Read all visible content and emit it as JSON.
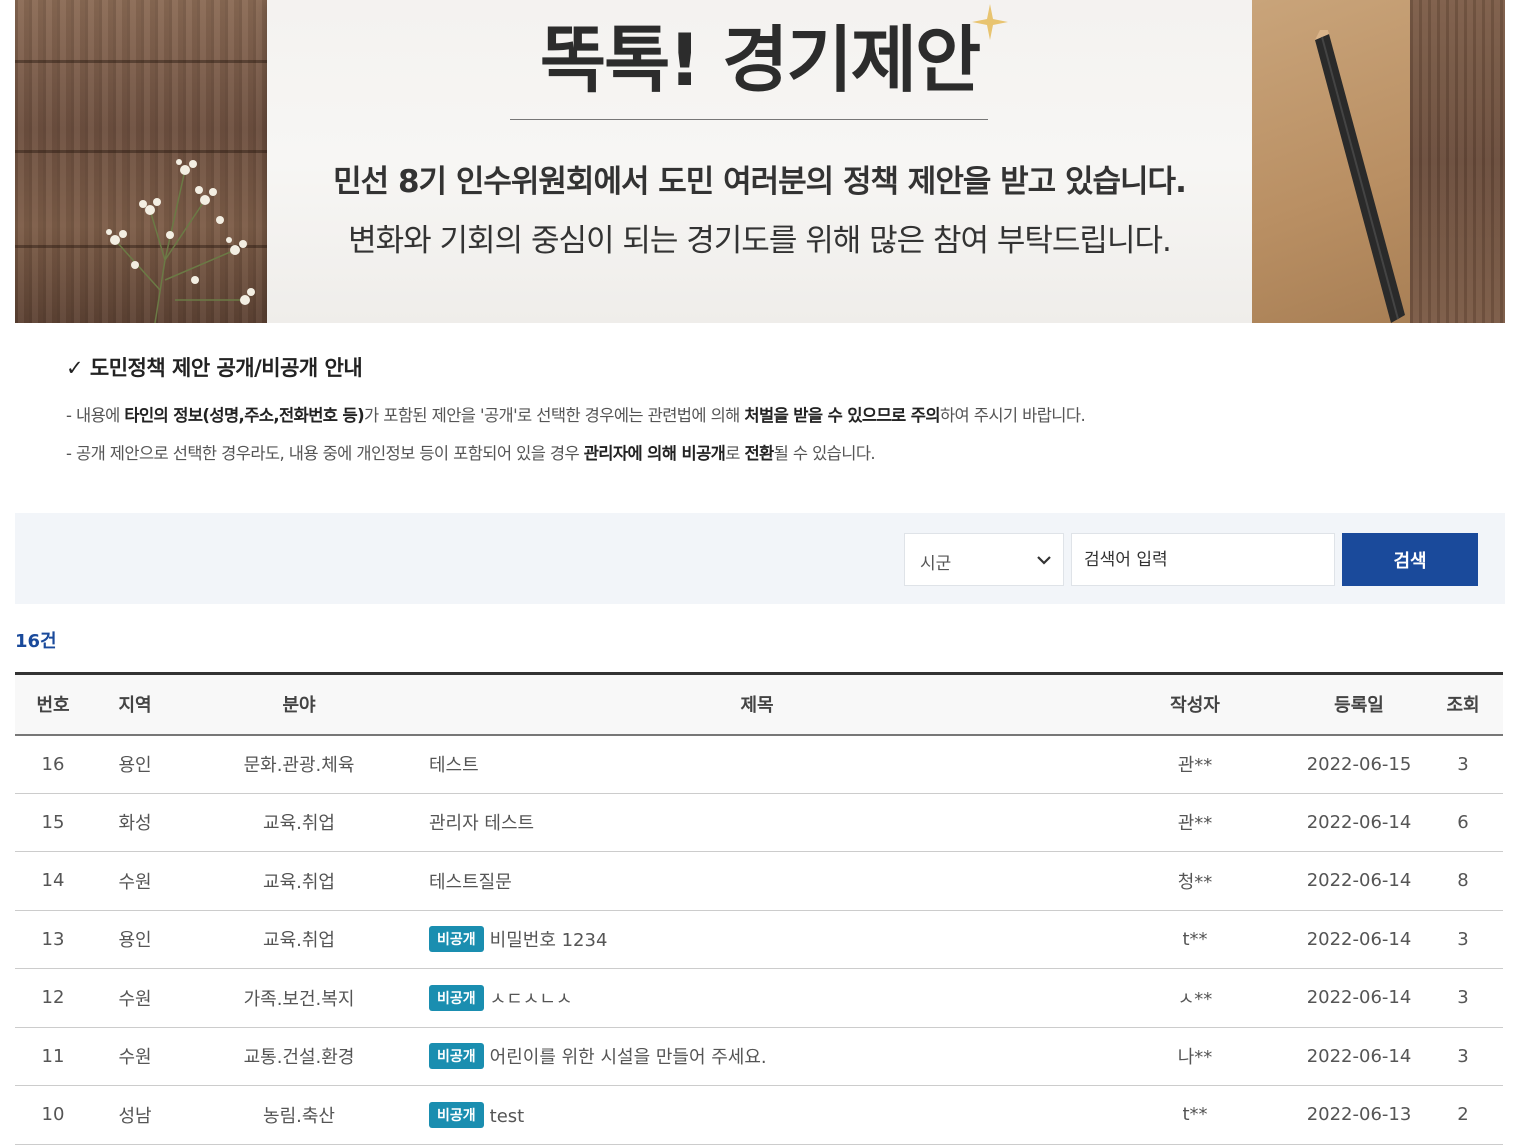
{
  "banner": {
    "title": "똑톡! 경기제안",
    "line1": "민선 8기 인수위원회에서 도민 여러분의 정책 제안을 받고 있습니다.",
    "line2": "변화와 기회의 중심이 되는 경기도를 위해 많은 참여 부탁드립니다."
  },
  "notice": {
    "title": "✓ 도민정책 제안 공개/비공개 안내",
    "line1": {
      "p1": "- 내용에 ",
      "b1": "타인의 정보(성명,주소,전화번호 등)",
      "p2": "가 포함된 제안을 '공개'로 선택한 경우에는 관련법에 의해 ",
      "b2": "처벌을 받을 수 있으므로 주의",
      "p3": "하여 주시기 바랍니다."
    },
    "line2": {
      "p1": "- 공개 제안으로 선택한 경우라도, 내용 중에 개인정보 등이 포함되어 있을 경우 ",
      "b1": "관리자에 의해 비공개",
      "p2": "로 ",
      "b2": "전환",
      "p3": "될 수 있습니다."
    }
  },
  "search": {
    "region_select": "시군",
    "input_placeholder": "검색어 입력",
    "button_label": "검색"
  },
  "total_count": "16건",
  "table": {
    "headers": {
      "no": "번호",
      "region": "지역",
      "category": "분야",
      "title": "제목",
      "author": "작성자",
      "date": "등록일",
      "views": "조회"
    },
    "private_label": "비공개",
    "rows": [
      {
        "no": "16",
        "region": "용인",
        "category": "문화.관광.체육",
        "title": "테스트",
        "private": false,
        "author": "관**",
        "date": "2022-06-15",
        "views": "3"
      },
      {
        "no": "15",
        "region": "화성",
        "category": "교육.취업",
        "title": "관리자 테스트",
        "private": false,
        "author": "관**",
        "date": "2022-06-14",
        "views": "6"
      },
      {
        "no": "14",
        "region": "수원",
        "category": "교육.취업",
        "title": "테스트질문",
        "private": false,
        "author": "청**",
        "date": "2022-06-14",
        "views": "8"
      },
      {
        "no": "13",
        "region": "용인",
        "category": "교육.취업",
        "title": "비밀번호 1234",
        "private": true,
        "author": "t**",
        "date": "2022-06-14",
        "views": "3"
      },
      {
        "no": "12",
        "region": "수원",
        "category": "가족.보건.복지",
        "title": "ㅅㄷㅅㄴㅅ",
        "private": true,
        "author": "ㅅ**",
        "date": "2022-06-14",
        "views": "3"
      },
      {
        "no": "11",
        "region": "수원",
        "category": "교통.건설.환경",
        "title": "어린이를 위한 시설을 만들어 주세요.",
        "private": true,
        "author": "나**",
        "date": "2022-06-14",
        "views": "3"
      },
      {
        "no": "10",
        "region": "성남",
        "category": "농림.축산",
        "title": "test",
        "private": true,
        "author": "t**",
        "date": "2022-06-13",
        "views": "2"
      }
    ]
  }
}
